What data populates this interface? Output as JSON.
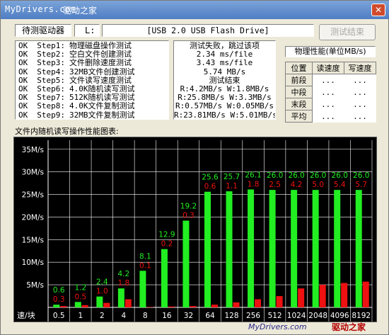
{
  "window": {
    "title": "MyDrivers.com",
    "watermark": "驱动之家"
  },
  "drive": {
    "label": "待测驱动器",
    "letter": "L:",
    "name": "[USB 2.0 USB Flash Drive]",
    "end_button": "测试结束"
  },
  "steps": [
    {
      "status": "OK",
      "name": "Step1:",
      "desc": "物理磁盘操作测试"
    },
    {
      "status": "OK",
      "name": "Step2:",
      "desc": "空白文件创建测试"
    },
    {
      "status": "OK",
      "name": "Step3:",
      "desc": "文件删除速度测试"
    },
    {
      "status": "OK",
      "name": "Step4:",
      "desc": "32MB文件创建测试"
    },
    {
      "status": "OK",
      "name": "Step5:",
      "desc": "文件读写速度测试"
    },
    {
      "status": "OK",
      "name": "Step6:",
      "desc": "4.0K随机读写测试"
    },
    {
      "status": "OK",
      "name": "Step7:",
      "desc": "512K随机读写测试"
    },
    {
      "status": "OK",
      "name": "Step8:",
      "desc": "4.0K文件复制测试"
    },
    {
      "status": "OK",
      "name": "Step9:",
      "desc": "32MB文件复制测试"
    }
  ],
  "results": [
    "测试失败，跳过该项",
    "2.34 ms/file",
    "3.43 ms/file",
    "5.74 MB/s",
    "测试结束",
    "R:4.2MB/s W:1.8MB/s",
    "R:25.8MB/s W:3.3MB/s",
    "R:0.57MB/s W:0.05MB/s",
    "R:23.81MB/s W:5.01MB/s"
  ],
  "perf": {
    "title": "物理性能(单位MB/s)",
    "headers": [
      "位置",
      "读速度",
      "写速度"
    ],
    "rows": [
      {
        "pos": "前段",
        "read": "...",
        "write": "..."
      },
      {
        "pos": "中段",
        "read": "...",
        "write": "..."
      },
      {
        "pos": "末段",
        "read": "...",
        "write": "..."
      },
      {
        "pos": "平均",
        "read": "...",
        "write": "..."
      }
    ]
  },
  "chart_title": "文件内随机读写操作性能图表:",
  "chart_data": {
    "type": "bar",
    "xlabel": "速/块",
    "categories": [
      "0.5",
      "1",
      "2",
      "4",
      "8",
      "16",
      "32",
      "64",
      "128",
      "256",
      "512",
      "1024",
      "2048",
      "4096",
      "8192"
    ],
    "y_ticks": [
      "5M/s",
      "10M/s",
      "15M/s",
      "20M/s",
      "25M/s",
      "30M/s",
      "35M/s"
    ],
    "ylim": [
      0,
      37
    ],
    "series": [
      {
        "color": "#22ee22",
        "values": [
          0.6,
          1.2,
          2.4,
          4.2,
          8.1,
          12.9,
          19.2,
          25.6,
          25.7,
          26.1,
          26.0,
          26.0,
          26.0,
          26.0,
          26.0
        ],
        "labels": [
          "0.6",
          "1.2",
          "2.4",
          "4.2",
          "8.1",
          "12.9",
          "19.2",
          "25.6",
          "25.7",
          "26.1",
          "26.0",
          "26.0",
          "26.0",
          "26.0",
          "26.0"
        ]
      },
      {
        "color": "#ee1111",
        "values": [
          0.3,
          0.5,
          1.0,
          1.8,
          0.1,
          0.2,
          0.3,
          0.6,
          1.1,
          1.8,
          2.5,
          4.2,
          5.0,
          5.4,
          5.7
        ],
        "labels": [
          "0.3",
          "0.5",
          "1.0",
          "1.8",
          "0.1",
          "0.2",
          "0.3",
          "0.6",
          "1.1",
          "1.8",
          "2.5",
          "4.2",
          "5.0",
          "5.4",
          "5.7"
        ]
      }
    ]
  },
  "footer": {
    "site": "MyDrivers.com",
    "brand": "驱动之家"
  }
}
